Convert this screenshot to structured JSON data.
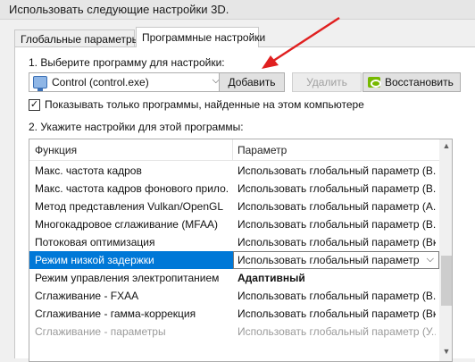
{
  "header": {
    "title": "Использовать следующие настройки 3D."
  },
  "tabs": [
    {
      "label": "Глобальные параметры"
    },
    {
      "label": "Программные настройки"
    }
  ],
  "step1_label": "1. Выберите программу для настройки:",
  "program_select": {
    "value": "Control (control.exe)"
  },
  "buttons": {
    "add": "Добавить",
    "remove": "Удалить",
    "restore": "Восстановить"
  },
  "checkbox": {
    "label": "Показывать только программы, найденные на этом компьютере",
    "checked": true,
    "mark": "✓"
  },
  "step2_label": "2. Укажите настройки для этой программы:",
  "table": {
    "headers": [
      "Функция",
      "Параметр"
    ],
    "rows": [
      {
        "feature": "Макс. частота кадров",
        "value": "Использовать глобальный параметр (В..."
      },
      {
        "feature": "Макс. частота кадров фонового прило...",
        "value": "Использовать глобальный параметр (В..."
      },
      {
        "feature": "Метод представления Vulkan/OpenGL",
        "value": "Использовать глобальный параметр (А..."
      },
      {
        "feature": "Многокадровое сглаживание (MFAA)",
        "value": "Использовать глобальный параметр (В..."
      },
      {
        "feature": "Потоковая оптимизация",
        "value": "Использовать глобальный параметр (Вкл)"
      },
      {
        "feature": "Режим низкой задержки",
        "value": "Использовать глобальный параметр (Вы"
      },
      {
        "feature": "Режим управления электропитанием",
        "value": "Адаптивный"
      },
      {
        "feature": "Сглаживание - FXAA",
        "value": "Использовать глобальный параметр (В..."
      },
      {
        "feature": "Сглаживание - гамма-коррекция",
        "value": "Использовать глобальный параметр (Вкл)"
      },
      {
        "feature": "Сглаживание - параметры",
        "value": "Использовать глобальный параметр (У..."
      }
    ],
    "selected_row": 5
  },
  "colors": {
    "selection": "#0078d7",
    "nvidia_green": "#76b900",
    "annotation_arrow": "#e02020"
  },
  "icons": {
    "program": "app-window-icon",
    "restore": "nvidia-icon",
    "dropdown": "chevron-down-icon"
  }
}
